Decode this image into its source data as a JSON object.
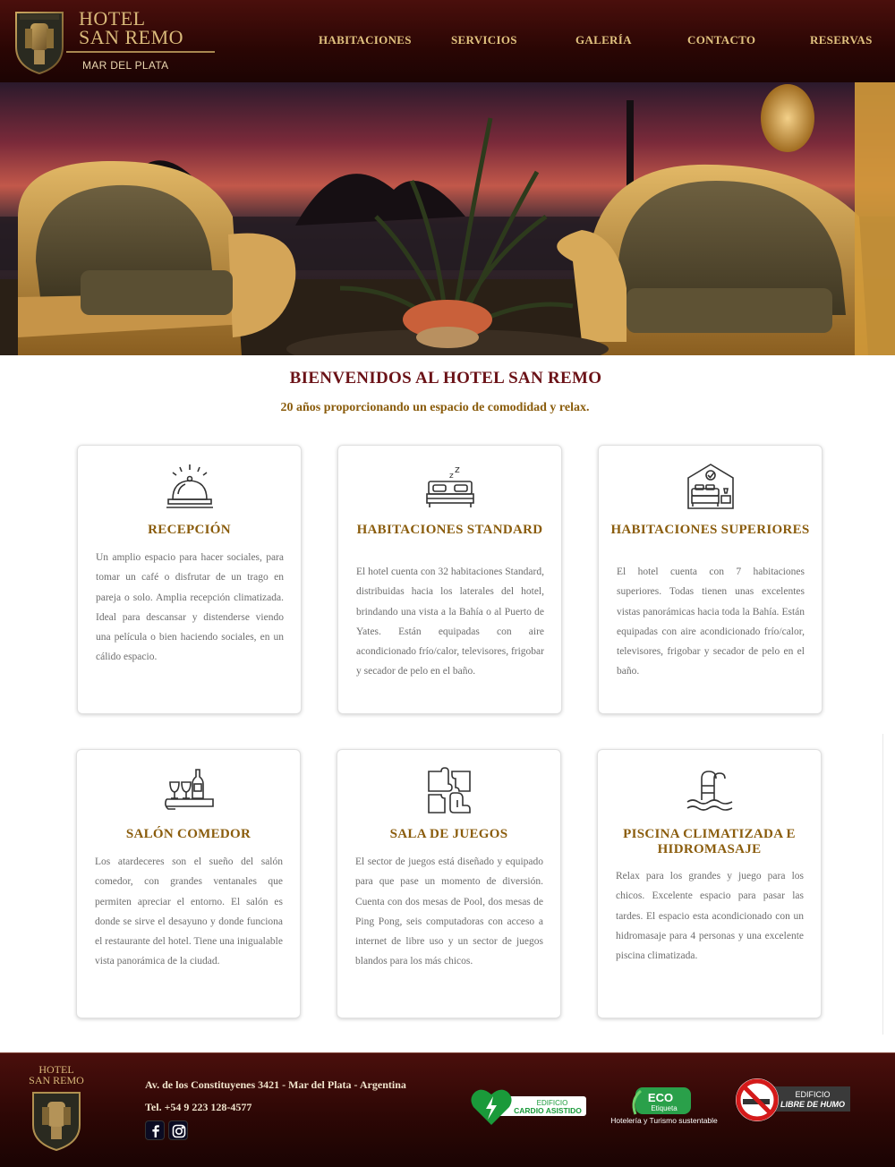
{
  "header": {
    "brand_line1": "HOTEL",
    "brand_line2": "SAN REMO",
    "brand_sub": "MAR DEL PLATA",
    "nav": [
      {
        "label": "HABITACIONES"
      },
      {
        "label": "SERVICIOS"
      },
      {
        "label": "GALERÍA"
      },
      {
        "label": "CONTACTO"
      },
      {
        "label": "RESERVAS"
      }
    ]
  },
  "intro": {
    "title": "BIENVENIDOS AL HOTEL SAN REMO",
    "subtitle": "20 años proporcionando un espacio de comodidad y relax."
  },
  "cards": [
    {
      "icon": "reception-bell-icon",
      "title": "RECEPCIÓN",
      "text": "Un amplio espacio para hacer sociales, para tomar un café o disfrutar de un trago en pareja o solo. Amplia recepción climatizada. Ideal para descansar y distenderse viendo una película o bien haciendo sociales, en un cálido espacio."
    },
    {
      "icon": "sleeping-bed-icon",
      "title": "HABITACIONES STANDARD",
      "text": "El hotel cuenta con 32 habitaciones Standard, distribuidas hacia los laterales del hotel, brindando una vista a la Bahía o al Puerto de Yates. Están equipadas con aire acondicionado frío/calor, televisores, frigobar y secador de pelo en el baño."
    },
    {
      "icon": "bedroom-check-icon",
      "title": "HABITACIONES SUPERIORES",
      "text": "El hotel cuenta con 7 habitaciones superiores. Todas tienen unas excelentes vistas panorámicas hacia toda la Bahía. Están equipadas con aire acondicionado frío/calor, televisores, frigobar y secador de pelo en el baño."
    },
    {
      "icon": "dining-tray-icon",
      "title": "SALÓN COMEDOR",
      "text": "Los atardeceres son el sueño del salón comedor, con grandes ventanales que permiten apreciar el entorno. El salón es donde se sirve el desayuno y donde funciona el restaurante del hotel. Tiene una inigualable vista panorámica de la ciudad."
    },
    {
      "icon": "puzzle-icon",
      "title": "SALA DE JUEGOS",
      "text": "El sector de juegos está diseñado y equipado para que pase un momento de diversión. Cuenta con dos mesas de Pool, dos mesas de Ping Pong, seis computadoras con acceso a internet de libre uso y un sector de juegos blandos para los más chicos."
    },
    {
      "icon": "pool-ladder-icon",
      "title": "PISCINA CLIMATIZADA E HIDROMASAJE",
      "text": "Relax para los grandes y juego para los chicos. Excelente espacio para pasar las tardes. El espacio esta acondicionado con un hidromasaje para 4 personas y una excelente piscina climatizada."
    }
  ],
  "footer": {
    "brand_line1": "HOTEL",
    "brand_line2": "SAN REMO",
    "address": "Av. de los Constituyenes 3421 - Mar del Plata - Argentina",
    "phone": "Tel. +54 9 223 128-4577",
    "social": [
      {
        "icon": "facebook-icon"
      },
      {
        "icon": "instagram-icon"
      }
    ],
    "badges": {
      "cardio": {
        "line1": "EDIFICIO",
        "line2": "CARDIO ASISTIDO"
      },
      "eco": {
        "label": "ECO",
        "sub": "Etiqueta",
        "caption": "Hotelería y Turismo sustentable"
      },
      "smoke": {
        "line1": "EDIFICIO",
        "line2": "LIBRE DE HUMO"
      }
    }
  },
  "colors": {
    "maroon": "#4a0f0c",
    "gold": "#d9b97a",
    "title_red": "#6b1217",
    "card_title": "#8a5c0c"
  }
}
